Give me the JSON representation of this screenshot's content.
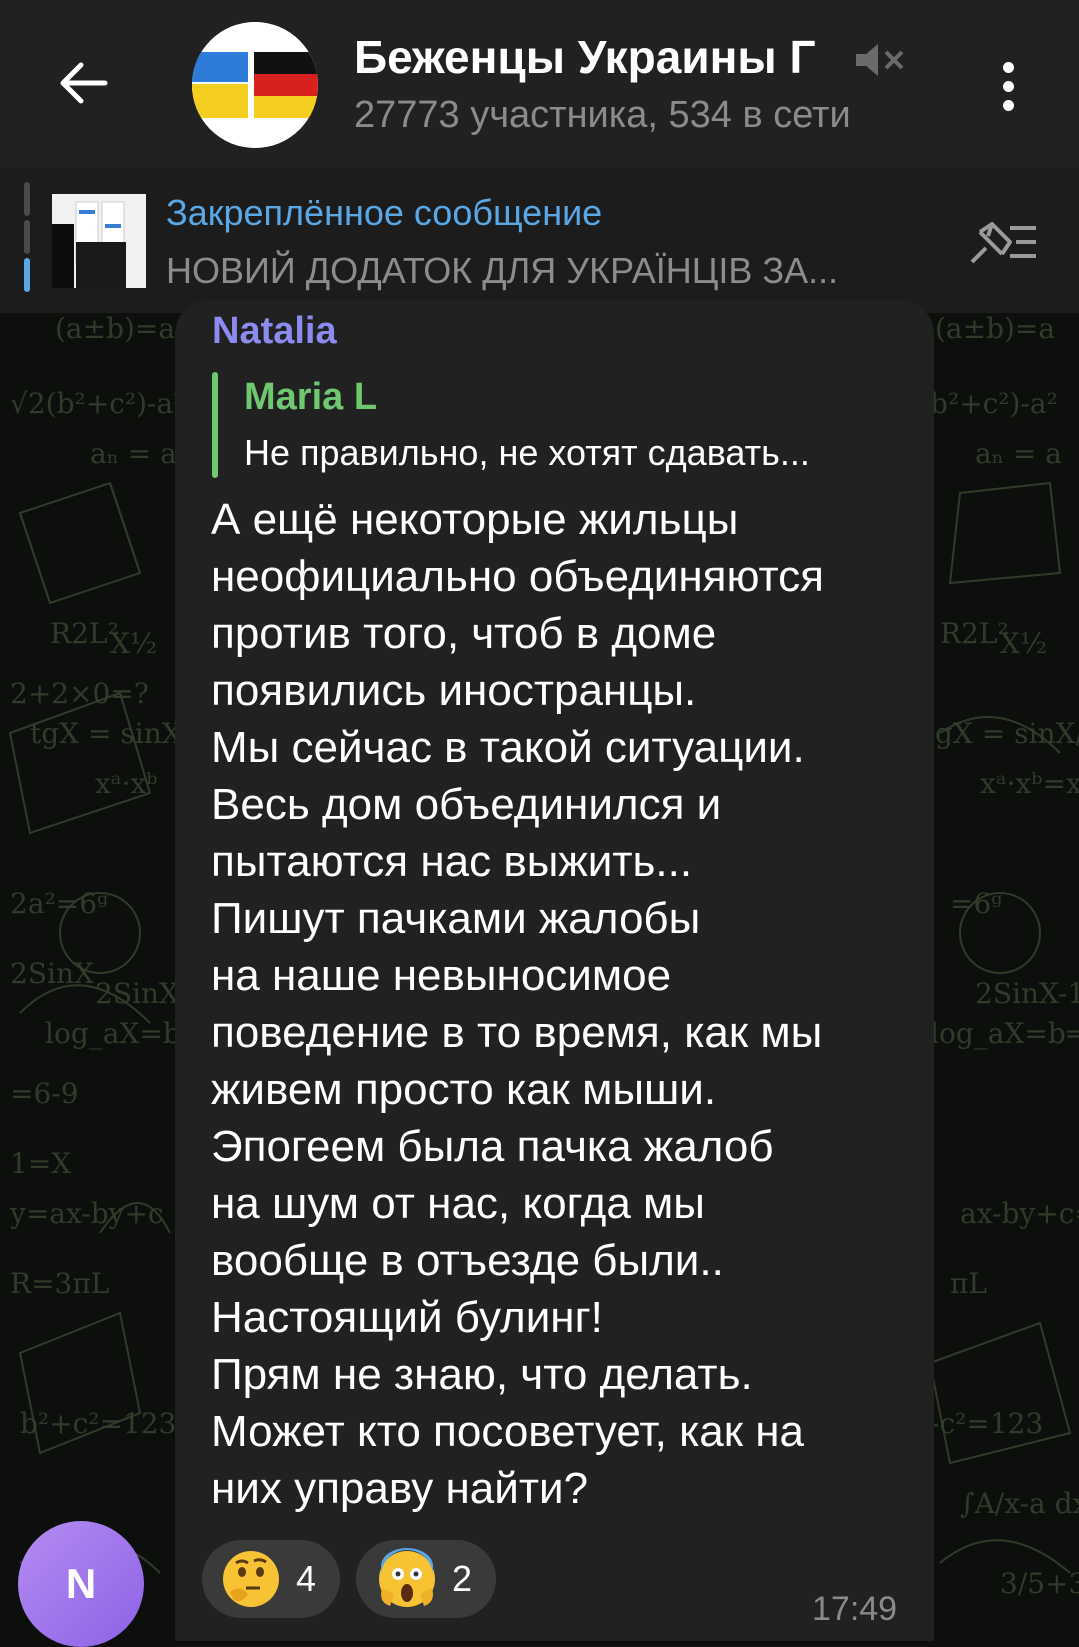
{
  "header": {
    "back_icon": "arrow-left-icon",
    "title": "Беженцы Украины Г",
    "subtitle": "27773 участника, 534 в сети",
    "mute_icon": "muted-speaker-icon",
    "menu_icon": "three-dots-vertical-icon"
  },
  "pinned": {
    "title": "Закреплённое сообщение",
    "text": "НОВИЙ ДОДАТОК ДЛЯ УКРАЇНЦІВ ЗА...",
    "list_icon": "pinned-list-icon"
  },
  "message": {
    "sender": "Natalia",
    "reply": {
      "name": "Maria L",
      "text": "Не правильно, не хотят сдавать..."
    },
    "text": "А ещё некоторые жильцы\nнеофициально объединяются\nпротив того, чтоб в доме\nпоявились иностранцы.\nМы сейчас в такой ситуации.\nВесь дом объединился и\nпытаются нас выжить...\nПишут пачками жалобы\nна наше невыносимое\nповедение в то время, как мы\nживем просто как мыши.\nЭпогеем была пачка жалоб\nна шум от нас, когда мы\nвообще в отъезде были..\nНастоящий булинг!\nПрям не знаю, что делать.\nМожет кто посоветует, как на\nних управу найти?",
    "reactions": [
      {
        "emoji": "thinking-face",
        "count": "4"
      },
      {
        "emoji": "screaming-face",
        "count": "2"
      }
    ],
    "time": "17:49",
    "avatar_letter": "N"
  },
  "colors": {
    "header_bg": "#212121",
    "pinned_bg": "#1c1c1c",
    "bubble_bg": "#212121",
    "accent_blue": "#5aa7e6",
    "sender_color": "#8c8cf0",
    "reply_color": "#6fc76f"
  }
}
